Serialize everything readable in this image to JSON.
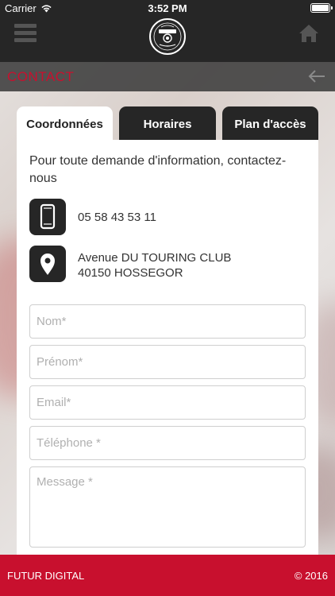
{
  "status_bar": {
    "carrier": "Carrier",
    "time": "3:52 PM",
    "battery_level_percent": 100
  },
  "nav": {
    "menu_icon": "hamburger-menu-icon",
    "logo_icon": "restaurant-logo-icon",
    "home_icon": "home-icon"
  },
  "section": {
    "title": "CONTACT",
    "back_icon": "arrow-left-icon"
  },
  "tabs": [
    {
      "label": "Coordonnées",
      "active": true
    },
    {
      "label": "Horaires",
      "active": false
    },
    {
      "label": "Plan d'accès",
      "active": false
    }
  ],
  "contact": {
    "intro": "Pour toute demande d'information, contactez-nous",
    "phone": "05 58 43 53 11",
    "address_line1": "Avenue DU TOURING CLUB",
    "address_line2": "40150 HOSSEGOR",
    "phone_icon": "smartphone-icon",
    "location_icon": "map-pin-icon"
  },
  "form": {
    "nom_placeholder": "Nom*",
    "prenom_placeholder": "Prénom*",
    "email_placeholder": "Email*",
    "telephone_placeholder": "Téléphone *",
    "message_placeholder": "Message *"
  },
  "footer": {
    "left": "FUTUR DIGITAL",
    "right": "© 2016"
  },
  "colors": {
    "accent": "#c8102e",
    "dark": "#262626",
    "white": "#ffffff"
  }
}
